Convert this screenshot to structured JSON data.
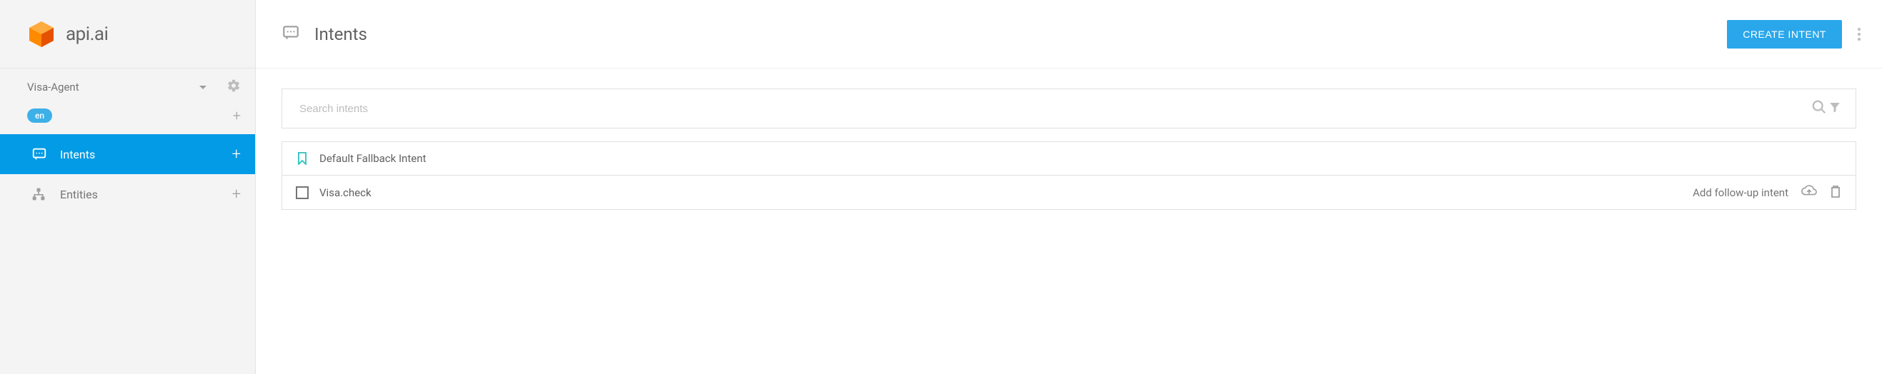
{
  "brand": {
    "name": "api.ai"
  },
  "agent": {
    "name": "Visa-Agent",
    "language": "en"
  },
  "nav": {
    "intents": {
      "label": "Intents"
    },
    "entities": {
      "label": "Entities"
    }
  },
  "header": {
    "title": "Intents",
    "create_label": "CREATE INTENT"
  },
  "search": {
    "placeholder": "Search intents"
  },
  "intents": [
    {
      "name": "Default Fallback Intent"
    },
    {
      "name": "Visa.check",
      "follow_up_label": "Add follow-up intent"
    }
  ]
}
